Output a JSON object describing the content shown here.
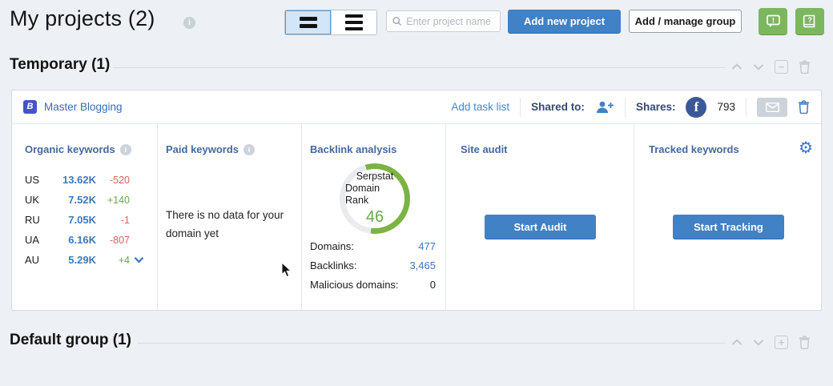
{
  "header": {
    "title": "My projects (2)",
    "search_placeholder": "Enter project name",
    "add_project": "Add new project",
    "add_group": "Add / manage group"
  },
  "sections": {
    "temporary_title": "Temporary (1)",
    "default_title": "Default group (1)",
    "collapse_glyph": "−",
    "expand_glyph": "+"
  },
  "project": {
    "favicon_letter": "B",
    "name": "Master Blogging",
    "add_task_list": "Add task list",
    "shared_to": "Shared to:",
    "shares": "Shares:",
    "shares_count": "793",
    "facebook_letter": "f"
  },
  "organic": {
    "title": "Organic keywords",
    "rows": [
      {
        "country": "US",
        "value": "13.62K",
        "delta": "-520"
      },
      {
        "country": "UK",
        "value": "7.52K",
        "delta": "+140"
      },
      {
        "country": "RU",
        "value": "7.05K",
        "delta": "-1"
      },
      {
        "country": "UA",
        "value": "6.16K",
        "delta": "-807"
      },
      {
        "country": "AU",
        "value": "5.29K",
        "delta": "+4"
      }
    ]
  },
  "paid": {
    "title": "Paid keywords",
    "empty_text": "There is no data for your domain yet"
  },
  "backlinks": {
    "title": "Backlink analysis",
    "donut_label_line1": "Serpstat",
    "donut_label_line2": "Domain Rank",
    "rank": "46",
    "stats": [
      {
        "label": "Domains:",
        "value": "477"
      },
      {
        "label": "Backlinks:",
        "value": "3,465"
      },
      {
        "label": "Malicious domains:",
        "value": "0"
      }
    ]
  },
  "site_audit": {
    "title": "Site audit",
    "button": "Start Audit"
  },
  "tracked": {
    "title": "Tracked keywords",
    "button": "Start Tracking"
  },
  "chart_data": {
    "type": "pie",
    "title": "Serpstat Domain Rank",
    "values": [
      46
    ],
    "max": 100,
    "arc_color": "#7cb342",
    "track_color": "#e9ebee"
  },
  "colors": {
    "accent_blue": "#4181c5",
    "link_blue": "#4a86c8",
    "value_blue": "#3b78c2",
    "delta_red": "#d4635c",
    "delta_green": "#67a74e",
    "donut_green": "#7cb342",
    "green_button": "#7cb75f",
    "facebook_blue": "#3b5998",
    "page_bg": "#edf0f4"
  }
}
